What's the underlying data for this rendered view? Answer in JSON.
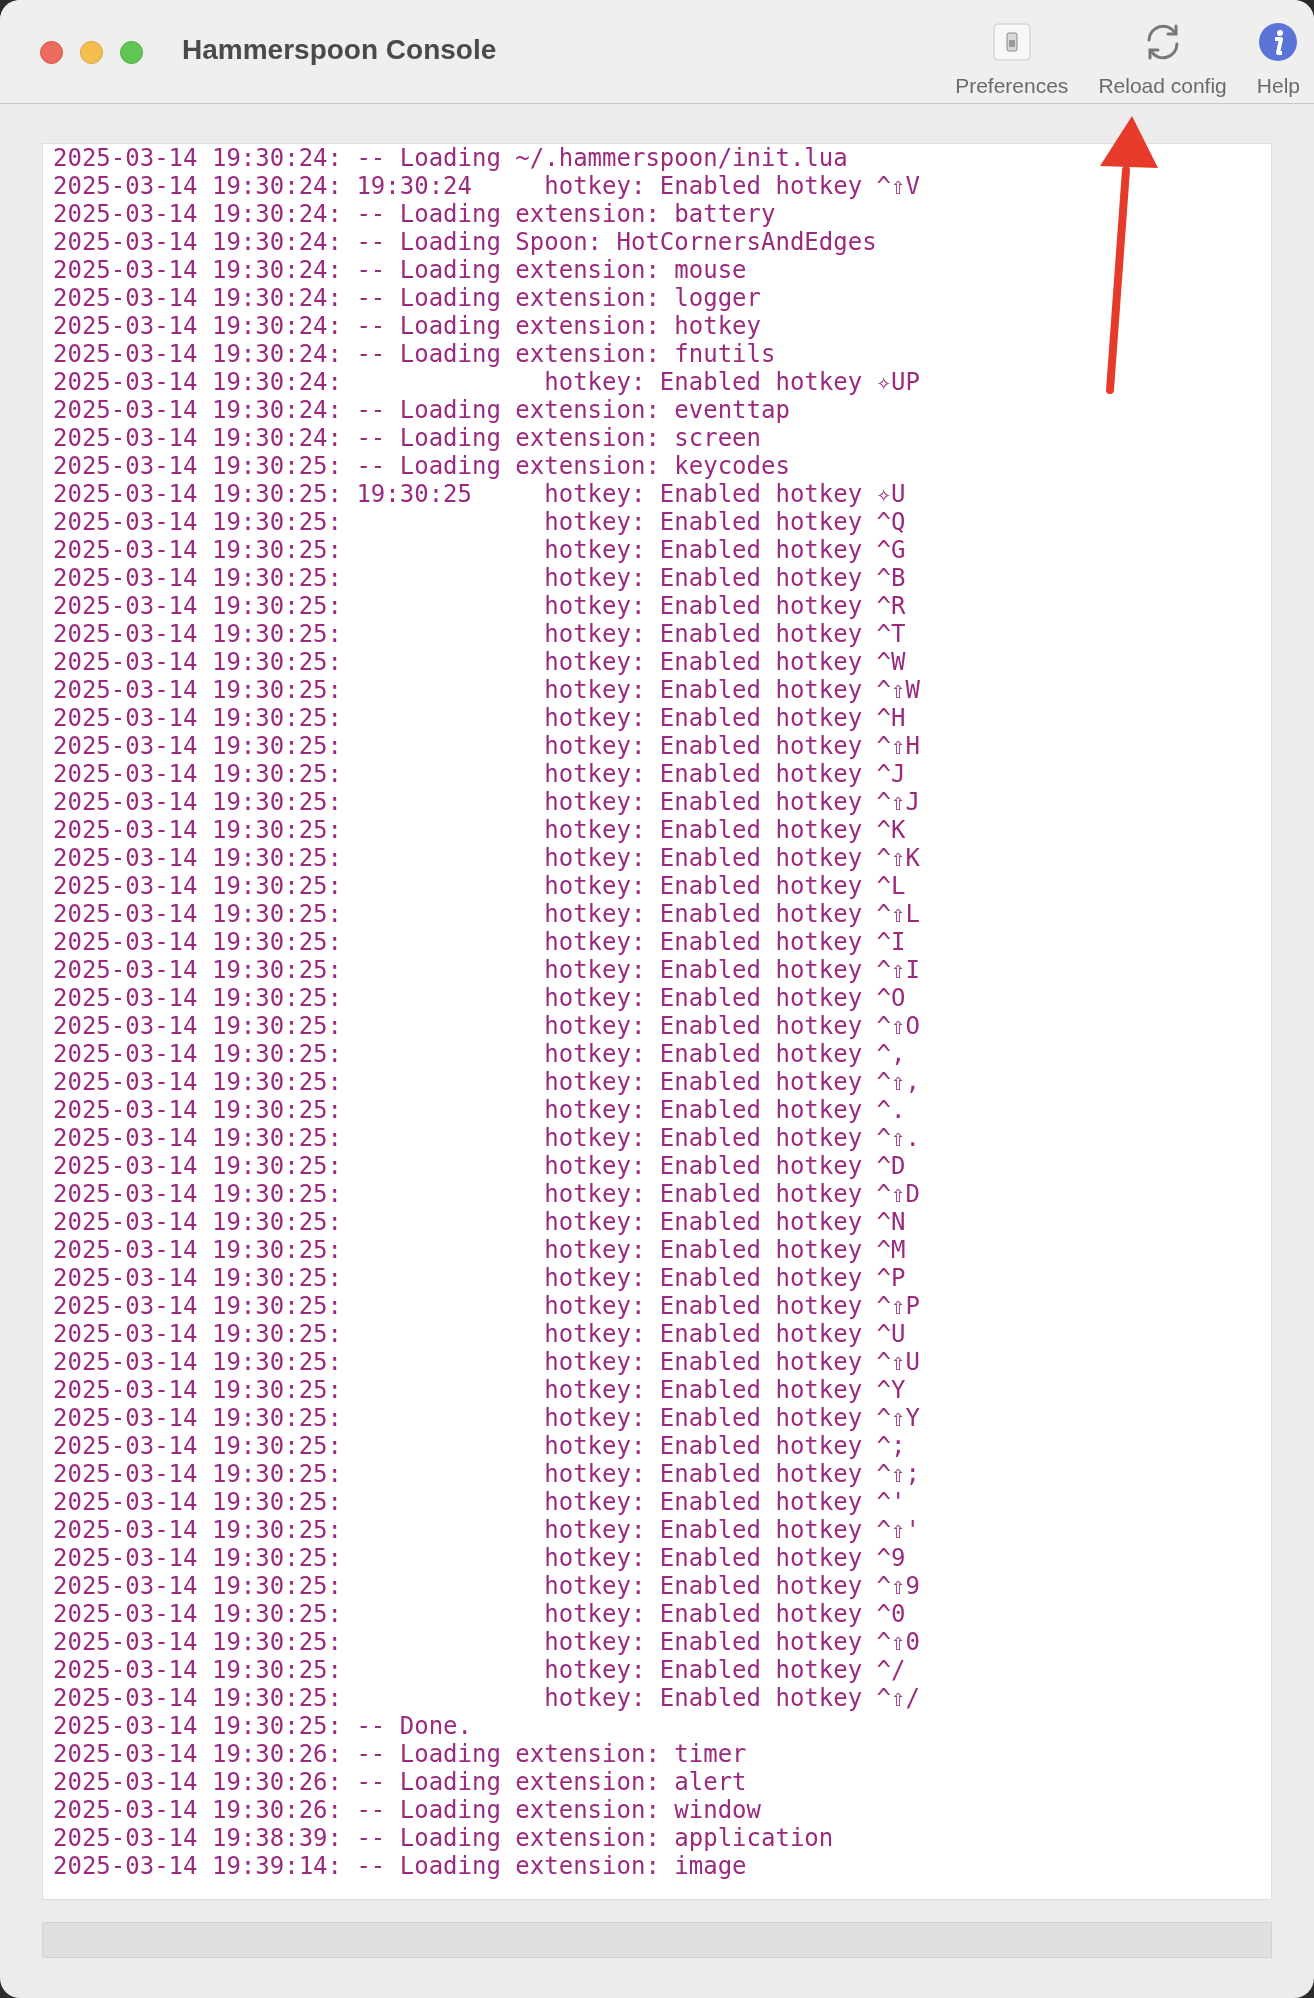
{
  "window": {
    "title": "Hammerspoon Console"
  },
  "toolbar": [
    {
      "kind": "preferences",
      "label": "Preferences"
    },
    {
      "kind": "reload",
      "label": "Reload config"
    },
    {
      "kind": "help",
      "label": "Help"
    }
  ],
  "log": [
    {
      "kind": "log",
      "stamp": "2025-03-14 19:30:24:",
      "text": "-- Loading ~/.hammerspoon/init.lua"
    },
    {
      "kind": "hotkey",
      "stamp": "2025-03-14 19:30:24:",
      "clock": "19:30:24",
      "text": "hotkey: Enabled hotkey ^⇧V"
    },
    {
      "kind": "log",
      "stamp": "2025-03-14 19:30:24:",
      "text": "-- Loading extension: battery"
    },
    {
      "kind": "log",
      "stamp": "2025-03-14 19:30:24:",
      "text": "-- Loading Spoon: HotCornersAndEdges"
    },
    {
      "kind": "log",
      "stamp": "2025-03-14 19:30:24:",
      "text": "-- Loading extension: mouse"
    },
    {
      "kind": "log",
      "stamp": "2025-03-14 19:30:24:",
      "text": "-- Loading extension: logger"
    },
    {
      "kind": "log",
      "stamp": "2025-03-14 19:30:24:",
      "text": "-- Loading extension: hotkey"
    },
    {
      "kind": "log",
      "stamp": "2025-03-14 19:30:24:",
      "text": "-- Loading extension: fnutils"
    },
    {
      "kind": "hotkey",
      "stamp": "2025-03-14 19:30:24:",
      "text": "hotkey: Enabled hotkey ✧UP"
    },
    {
      "kind": "log",
      "stamp": "2025-03-14 19:30:24:",
      "text": "-- Loading extension: eventtap"
    },
    {
      "kind": "log",
      "stamp": "2025-03-14 19:30:24:",
      "text": "-- Loading extension: screen"
    },
    {
      "kind": "log",
      "stamp": "2025-03-14 19:30:25:",
      "text": "-- Loading extension: keycodes"
    },
    {
      "kind": "hotkey",
      "stamp": "2025-03-14 19:30:25:",
      "clock": "19:30:25",
      "text": "hotkey: Enabled hotkey ✧U"
    },
    {
      "kind": "hotkey",
      "stamp": "2025-03-14 19:30:25:",
      "text": "hotkey: Enabled hotkey ^Q"
    },
    {
      "kind": "hotkey",
      "stamp": "2025-03-14 19:30:25:",
      "text": "hotkey: Enabled hotkey ^G"
    },
    {
      "kind": "hotkey",
      "stamp": "2025-03-14 19:30:25:",
      "text": "hotkey: Enabled hotkey ^B"
    },
    {
      "kind": "hotkey",
      "stamp": "2025-03-14 19:30:25:",
      "text": "hotkey: Enabled hotkey ^R"
    },
    {
      "kind": "hotkey",
      "stamp": "2025-03-14 19:30:25:",
      "text": "hotkey: Enabled hotkey ^T"
    },
    {
      "kind": "hotkey",
      "stamp": "2025-03-14 19:30:25:",
      "text": "hotkey: Enabled hotkey ^W"
    },
    {
      "kind": "hotkey",
      "stamp": "2025-03-14 19:30:25:",
      "text": "hotkey: Enabled hotkey ^⇧W"
    },
    {
      "kind": "hotkey",
      "stamp": "2025-03-14 19:30:25:",
      "text": "hotkey: Enabled hotkey ^H"
    },
    {
      "kind": "hotkey",
      "stamp": "2025-03-14 19:30:25:",
      "text": "hotkey: Enabled hotkey ^⇧H"
    },
    {
      "kind": "hotkey",
      "stamp": "2025-03-14 19:30:25:",
      "text": "hotkey: Enabled hotkey ^J"
    },
    {
      "kind": "hotkey",
      "stamp": "2025-03-14 19:30:25:",
      "text": "hotkey: Enabled hotkey ^⇧J"
    },
    {
      "kind": "hotkey",
      "stamp": "2025-03-14 19:30:25:",
      "text": "hotkey: Enabled hotkey ^K"
    },
    {
      "kind": "hotkey",
      "stamp": "2025-03-14 19:30:25:",
      "text": "hotkey: Enabled hotkey ^⇧K"
    },
    {
      "kind": "hotkey",
      "stamp": "2025-03-14 19:30:25:",
      "text": "hotkey: Enabled hotkey ^L"
    },
    {
      "kind": "hotkey",
      "stamp": "2025-03-14 19:30:25:",
      "text": "hotkey: Enabled hotkey ^⇧L"
    },
    {
      "kind": "hotkey",
      "stamp": "2025-03-14 19:30:25:",
      "text": "hotkey: Enabled hotkey ^I"
    },
    {
      "kind": "hotkey",
      "stamp": "2025-03-14 19:30:25:",
      "text": "hotkey: Enabled hotkey ^⇧I"
    },
    {
      "kind": "hotkey",
      "stamp": "2025-03-14 19:30:25:",
      "text": "hotkey: Enabled hotkey ^O"
    },
    {
      "kind": "hotkey",
      "stamp": "2025-03-14 19:30:25:",
      "text": "hotkey: Enabled hotkey ^⇧O"
    },
    {
      "kind": "hotkey",
      "stamp": "2025-03-14 19:30:25:",
      "text": "hotkey: Enabled hotkey ^,"
    },
    {
      "kind": "hotkey",
      "stamp": "2025-03-14 19:30:25:",
      "text": "hotkey: Enabled hotkey ^⇧,"
    },
    {
      "kind": "hotkey",
      "stamp": "2025-03-14 19:30:25:",
      "text": "hotkey: Enabled hotkey ^."
    },
    {
      "kind": "hotkey",
      "stamp": "2025-03-14 19:30:25:",
      "text": "hotkey: Enabled hotkey ^⇧."
    },
    {
      "kind": "hotkey",
      "stamp": "2025-03-14 19:30:25:",
      "text": "hotkey: Enabled hotkey ^D"
    },
    {
      "kind": "hotkey",
      "stamp": "2025-03-14 19:30:25:",
      "text": "hotkey: Enabled hotkey ^⇧D"
    },
    {
      "kind": "hotkey",
      "stamp": "2025-03-14 19:30:25:",
      "text": "hotkey: Enabled hotkey ^N"
    },
    {
      "kind": "hotkey",
      "stamp": "2025-03-14 19:30:25:",
      "text": "hotkey: Enabled hotkey ^M"
    },
    {
      "kind": "hotkey",
      "stamp": "2025-03-14 19:30:25:",
      "text": "hotkey: Enabled hotkey ^P"
    },
    {
      "kind": "hotkey",
      "stamp": "2025-03-14 19:30:25:",
      "text": "hotkey: Enabled hotkey ^⇧P"
    },
    {
      "kind": "hotkey",
      "stamp": "2025-03-14 19:30:25:",
      "text": "hotkey: Enabled hotkey ^U"
    },
    {
      "kind": "hotkey",
      "stamp": "2025-03-14 19:30:25:",
      "text": "hotkey: Enabled hotkey ^⇧U"
    },
    {
      "kind": "hotkey",
      "stamp": "2025-03-14 19:30:25:",
      "text": "hotkey: Enabled hotkey ^Y"
    },
    {
      "kind": "hotkey",
      "stamp": "2025-03-14 19:30:25:",
      "text": "hotkey: Enabled hotkey ^⇧Y"
    },
    {
      "kind": "hotkey",
      "stamp": "2025-03-14 19:30:25:",
      "text": "hotkey: Enabled hotkey ^;"
    },
    {
      "kind": "hotkey",
      "stamp": "2025-03-14 19:30:25:",
      "text": "hotkey: Enabled hotkey ^⇧;"
    },
    {
      "kind": "hotkey",
      "stamp": "2025-03-14 19:30:25:",
      "text": "hotkey: Enabled hotkey ^'"
    },
    {
      "kind": "hotkey",
      "stamp": "2025-03-14 19:30:25:",
      "text": "hotkey: Enabled hotkey ^⇧'"
    },
    {
      "kind": "hotkey",
      "stamp": "2025-03-14 19:30:25:",
      "text": "hotkey: Enabled hotkey ^9"
    },
    {
      "kind": "hotkey",
      "stamp": "2025-03-14 19:30:25:",
      "text": "hotkey: Enabled hotkey ^⇧9"
    },
    {
      "kind": "hotkey",
      "stamp": "2025-03-14 19:30:25:",
      "text": "hotkey: Enabled hotkey ^0"
    },
    {
      "kind": "hotkey",
      "stamp": "2025-03-14 19:30:25:",
      "text": "hotkey: Enabled hotkey ^⇧0"
    },
    {
      "kind": "hotkey",
      "stamp": "2025-03-14 19:30:25:",
      "text": "hotkey: Enabled hotkey ^/"
    },
    {
      "kind": "hotkey",
      "stamp": "2025-03-14 19:30:25:",
      "text": "hotkey: Enabled hotkey ^⇧/"
    },
    {
      "kind": "log",
      "stamp": "2025-03-14 19:30:25:",
      "text": "-- Done."
    },
    {
      "kind": "log",
      "stamp": "2025-03-14 19:30:26:",
      "text": "-- Loading extension: timer"
    },
    {
      "kind": "log",
      "stamp": "2025-03-14 19:30:26:",
      "text": "-- Loading extension: alert"
    },
    {
      "kind": "log",
      "stamp": "2025-03-14 19:30:26:",
      "text": "-- Loading extension: window"
    },
    {
      "kind": "log",
      "stamp": "2025-03-14 19:38:39:",
      "text": "-- Loading extension: application"
    },
    {
      "kind": "log",
      "stamp": "2025-03-14 19:39:14:",
      "text": "-- Loading extension: image"
    }
  ]
}
